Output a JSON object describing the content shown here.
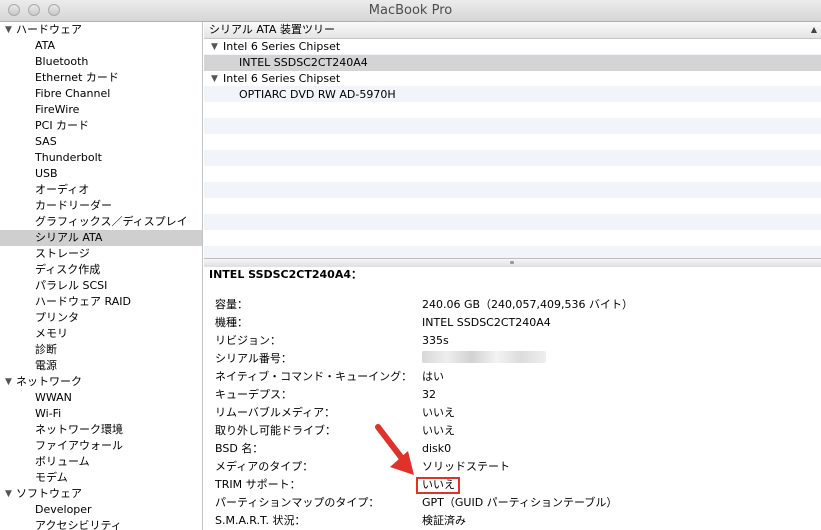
{
  "window": {
    "title": "MacBook Pro"
  },
  "sidebar": {
    "rows": [
      {
        "type": "cat",
        "label": "ハードウェア",
        "name": "sidebar-cat-hardware"
      },
      {
        "type": "item",
        "label": "ATA",
        "name": "sidebar-item-ata"
      },
      {
        "type": "item",
        "label": "Bluetooth",
        "name": "sidebar-item-bluetooth"
      },
      {
        "type": "item",
        "label": "Ethernet カード",
        "name": "sidebar-item-ethernet"
      },
      {
        "type": "item",
        "label": "Fibre Channel",
        "name": "sidebar-item-fibre-channel"
      },
      {
        "type": "item",
        "label": "FireWire",
        "name": "sidebar-item-firewire"
      },
      {
        "type": "item",
        "label": "PCI カード",
        "name": "sidebar-item-pci"
      },
      {
        "type": "item",
        "label": "SAS",
        "name": "sidebar-item-sas"
      },
      {
        "type": "item",
        "label": "Thunderbolt",
        "name": "sidebar-item-thunderbolt"
      },
      {
        "type": "item",
        "label": "USB",
        "name": "sidebar-item-usb"
      },
      {
        "type": "item",
        "label": "オーディオ",
        "name": "sidebar-item-audio"
      },
      {
        "type": "item",
        "label": "カードリーダー",
        "name": "sidebar-item-card-reader"
      },
      {
        "type": "item",
        "label": "グラフィックス／ディスプレイ",
        "name": "sidebar-item-graphics"
      },
      {
        "type": "item",
        "label": "シリアル ATA",
        "name": "sidebar-item-serial-ata",
        "selected": true
      },
      {
        "type": "item",
        "label": "ストレージ",
        "name": "sidebar-item-storage"
      },
      {
        "type": "item",
        "label": "ディスク作成",
        "name": "sidebar-item-disc-burning"
      },
      {
        "type": "item",
        "label": "パラレル SCSI",
        "name": "sidebar-item-parallel-scsi"
      },
      {
        "type": "item",
        "label": "ハードウェア RAID",
        "name": "sidebar-item-hardware-raid"
      },
      {
        "type": "item",
        "label": "プリンタ",
        "name": "sidebar-item-printers"
      },
      {
        "type": "item",
        "label": "メモリ",
        "name": "sidebar-item-memory"
      },
      {
        "type": "item",
        "label": "診断",
        "name": "sidebar-item-diagnostics"
      },
      {
        "type": "item",
        "label": "電源",
        "name": "sidebar-item-power"
      },
      {
        "type": "cat",
        "label": "ネットワーク",
        "name": "sidebar-cat-network"
      },
      {
        "type": "item",
        "label": "WWAN",
        "name": "sidebar-item-wwan"
      },
      {
        "type": "item",
        "label": "Wi-Fi",
        "name": "sidebar-item-wifi"
      },
      {
        "type": "item",
        "label": "ネットワーク環境",
        "name": "sidebar-item-locations"
      },
      {
        "type": "item",
        "label": "ファイアウォール",
        "name": "sidebar-item-firewall"
      },
      {
        "type": "item",
        "label": "ボリューム",
        "name": "sidebar-item-volumes"
      },
      {
        "type": "item",
        "label": "モデム",
        "name": "sidebar-item-modems"
      },
      {
        "type": "cat",
        "label": "ソフトウェア",
        "name": "sidebar-cat-software"
      },
      {
        "type": "item",
        "label": "Developer",
        "name": "sidebar-item-developer"
      },
      {
        "type": "item",
        "label": "アクセシビリティ",
        "name": "sidebar-item-accessibility"
      }
    ]
  },
  "tree": {
    "header": "シリアル ATA 装置ツリー",
    "rows": [
      {
        "type": "parent",
        "label": "Intel 6 Series Chipset"
      },
      {
        "type": "child",
        "label": "INTEL SSDSC2CT240A4",
        "selected": true
      },
      {
        "type": "parent",
        "label": "Intel 6 Series Chipset"
      },
      {
        "type": "child",
        "label": "OPTIARC DVD RW AD-5970H"
      }
    ]
  },
  "detail": {
    "title": "INTEL SSDSC2CT240A4：",
    "props": [
      {
        "key": "容量：",
        "value": "240.06 GB（240,057,409,536 バイト）"
      },
      {
        "key": "機種：",
        "value": "INTEL SSDSC2CT240A4"
      },
      {
        "key": "リビジョン：",
        "value": "335s"
      },
      {
        "key": "シリアル番号：",
        "value": ""
      },
      {
        "key": "ネイティブ・コマンド・キューイング：",
        "value": "はい"
      },
      {
        "key": "キューデプス：",
        "value": "32"
      },
      {
        "key": "リムーバブルメディア：",
        "value": "いいえ"
      },
      {
        "key": "取り外し可能ドライブ：",
        "value": "いいえ"
      },
      {
        "key": "BSD 名：",
        "value": "disk0"
      },
      {
        "key": "メディアのタイプ：",
        "value": "ソリッドステート"
      },
      {
        "key": "TRIM サポート：",
        "value": "いいえ"
      },
      {
        "key": "パーティションマップのタイプ：",
        "value": "GPT（GUID パーティションテーブル）"
      },
      {
        "key": "S.M.A.R.T. 状況：",
        "value": "検証済み"
      }
    ]
  },
  "colors": {
    "highlight": "#e0312b"
  }
}
